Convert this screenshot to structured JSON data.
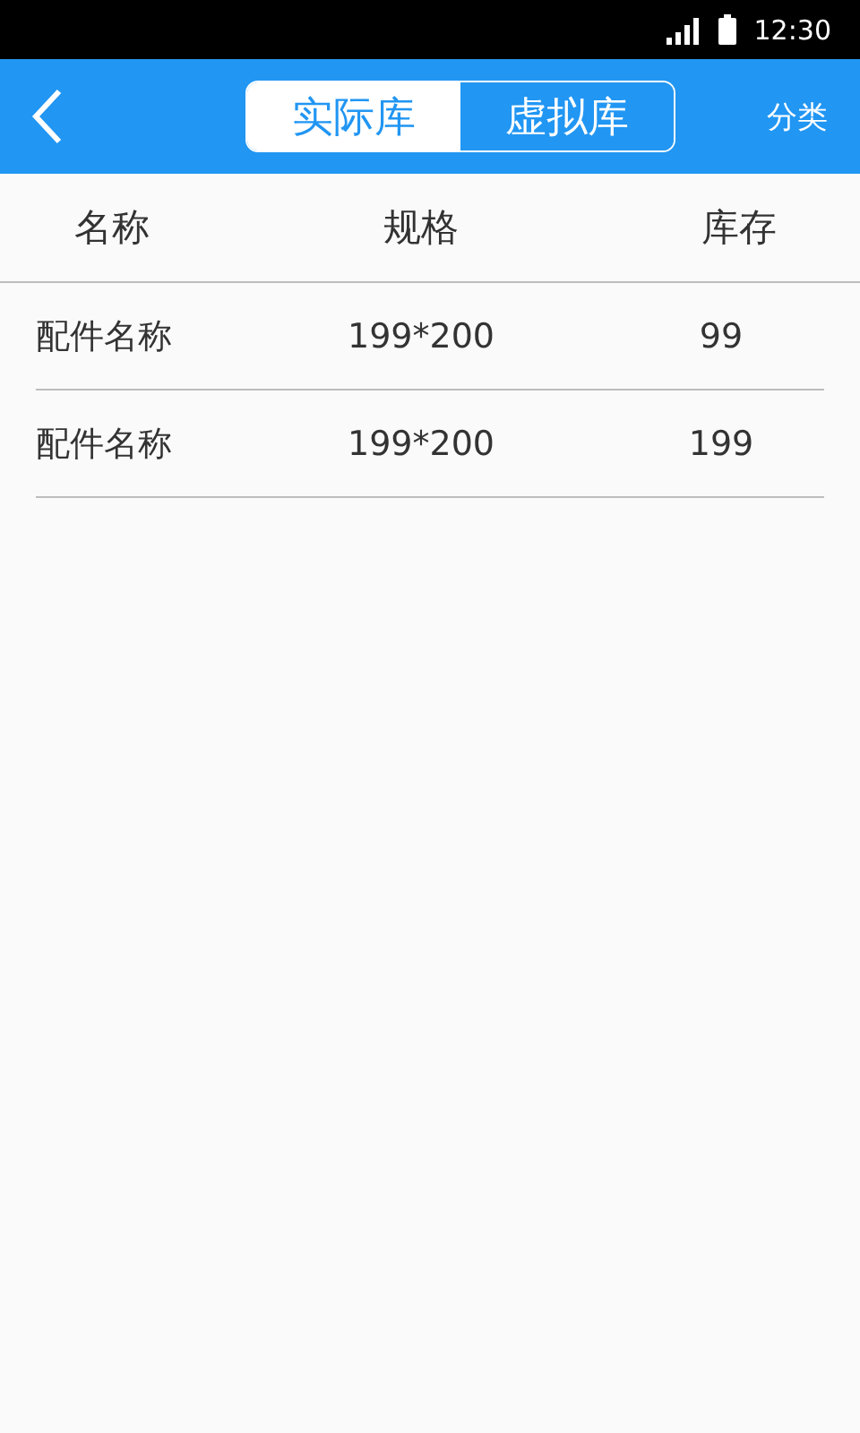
{
  "status_bar": {
    "time": "12:30"
  },
  "header": {
    "segments": [
      {
        "label": "实际库",
        "selected": true
      },
      {
        "label": "虚拟库",
        "selected": false
      }
    ],
    "action": "分类"
  },
  "table": {
    "columns": [
      "名称",
      "规格",
      "库存"
    ],
    "rows": [
      [
        "配件名称",
        "199*200",
        "99"
      ],
      [
        "配件名称",
        "199*200",
        "199"
      ]
    ]
  }
}
